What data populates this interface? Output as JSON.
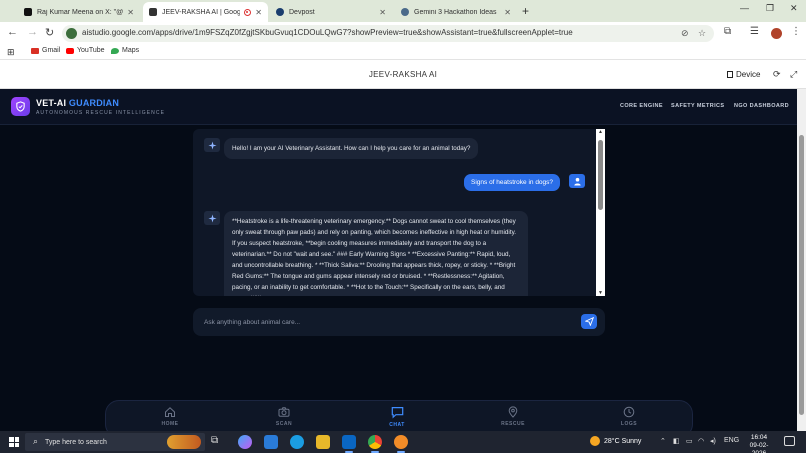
{
  "browser": {
    "tabs": [
      {
        "title": "Raj Kumar Meena on X: \"@sau",
        "active": false
      },
      {
        "title": "JEEV-RAKSHA AI | Google A",
        "active": true
      },
      {
        "title": "Devpost",
        "active": false
      },
      {
        "title": "Gemini 3 Hackathon Ideas",
        "active": false
      }
    ],
    "url": "aistudio.google.com/apps/drive/1m9FSZqZ0fZgjtSKbuGvuq1CDOuLQwG7?showPreview=true&showAssistant=true&fullscreenApplet=true",
    "bookmarks": [
      "Gmail",
      "YouTube",
      "Maps"
    ]
  },
  "studio": {
    "title": "JEEV-RAKSHA AI",
    "device_label": "Device"
  },
  "app": {
    "brand_main": "VET-AI",
    "brand_accent": "GUARDIAN",
    "tagline": "AUTONOMOUS RESCUE INTELLIGENCE",
    "top_nav": [
      "CORE ENGINE",
      "SAFETY METRICS",
      "NGO DASHBOARD"
    ],
    "messages": [
      {
        "role": "bot",
        "text": "Hello! I am your AI Veterinary Assistant. How can I help you care for an animal today?"
      },
      {
        "role": "user",
        "text": "Signs of heatstroke in dogs?"
      },
      {
        "role": "bot",
        "text": "**Heatstroke is a life-threatening veterinary emergency.** Dogs cannot sweat to cool themselves (they only sweat through paw pads) and rely on panting, which becomes ineffective in high heat or humidity. If you suspect heatstroke, **begin cooling measures immediately and transport the dog to a veterinarian.** Do not \"wait and see.\" ### Early Warning Signs * **Excessive Panting:** Rapid, loud, and uncontrollable breathing. * **Thick Saliva:** Drooling that appears thick, ropey, or sticky. * **Bright Red Gums:** The tongue and gums appear intensely red or bruised. * **Restlessness:** Agitation, pacing, or an inability to get comfortable. * **Hot to the Touch:** Specifically on the ears, belly, and paws. ###"
      }
    ],
    "input_placeholder": "Ask anything about animal care...",
    "bottom_nav": [
      {
        "label": "HOME",
        "icon": "home-icon",
        "active": false
      },
      {
        "label": "SCAN",
        "icon": "camera-icon",
        "active": false
      },
      {
        "label": "CHAT",
        "icon": "chat-icon",
        "active": true
      },
      {
        "label": "RESCUE",
        "icon": "location-pin-icon",
        "active": false
      },
      {
        "label": "LOGS",
        "icon": "clock-icon",
        "active": false
      }
    ],
    "colors": {
      "accent": "#3f8cff",
      "user_bubble": "#2b6ee8",
      "background": "#050b16"
    }
  },
  "taskbar": {
    "search_placeholder": "Type here to search",
    "weather": "28°C  Sunny",
    "language": "ENG",
    "time": "16:04",
    "date": "09-02-2026"
  }
}
